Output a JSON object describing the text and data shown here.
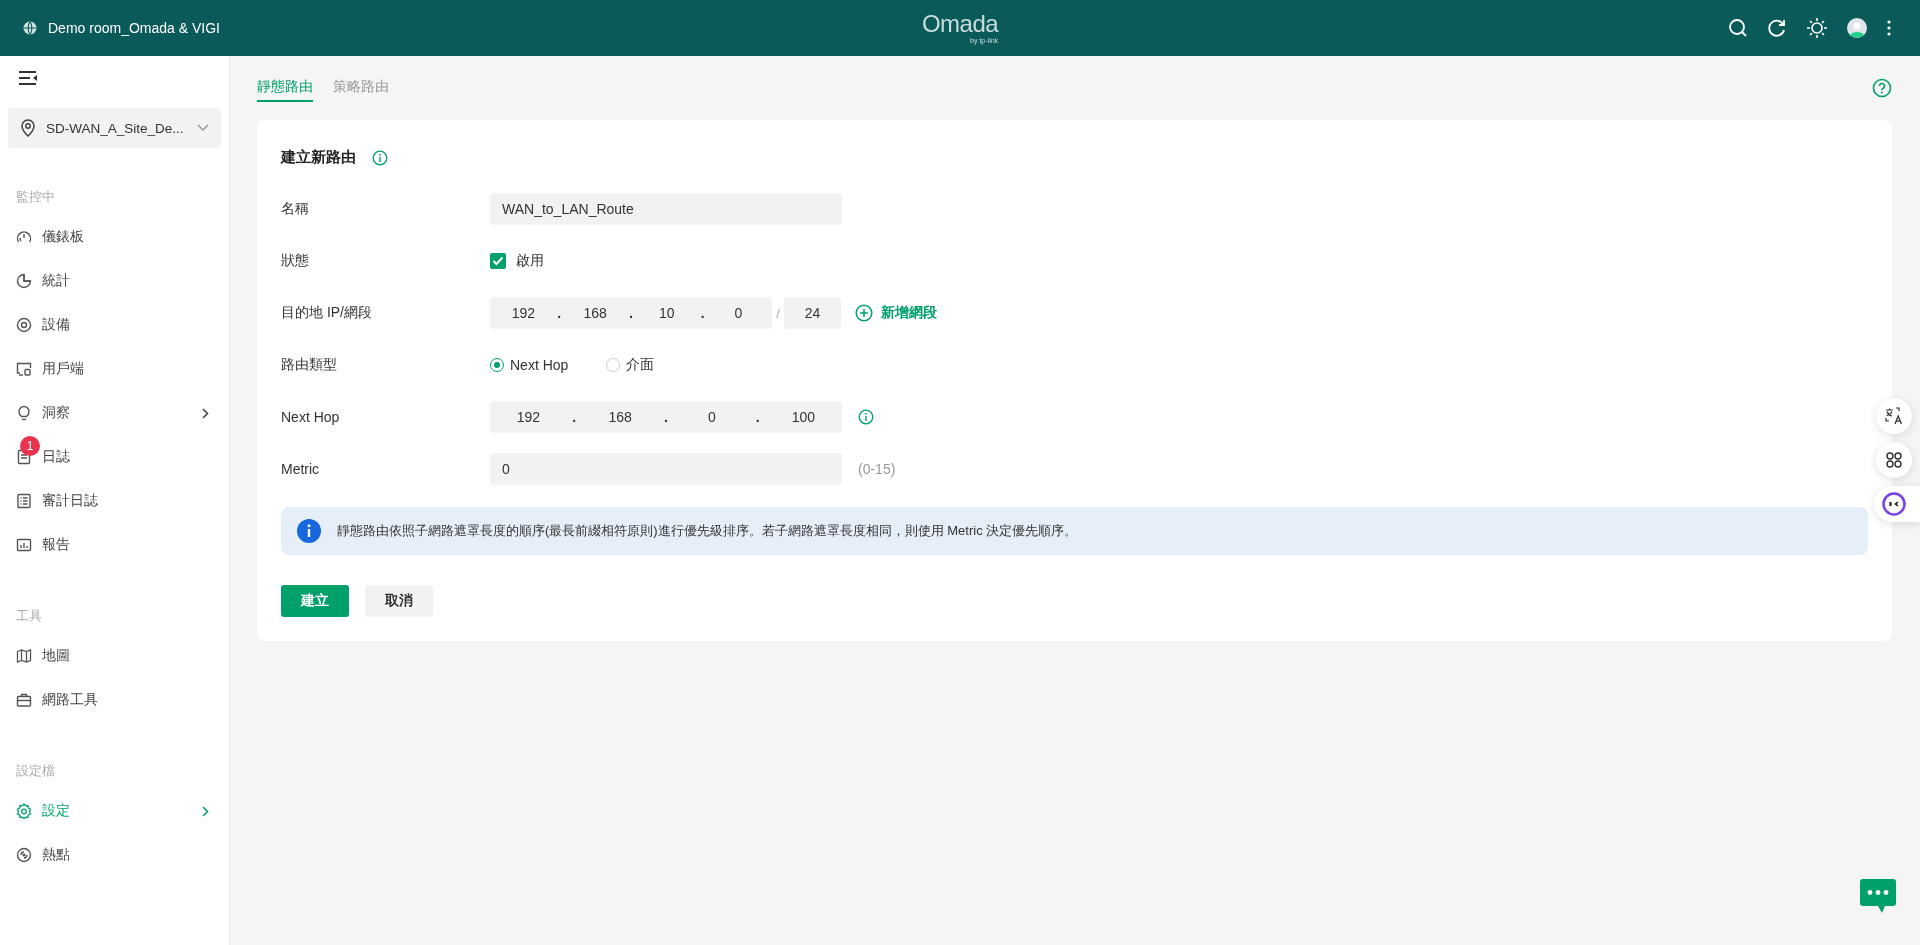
{
  "topbar": {
    "site_title": "Demo room_Omada & VIGI",
    "logo": "Omada",
    "logo_sub": "by tp-link"
  },
  "sidebar": {
    "site_selector": "SD-WAN_A_Site_De...",
    "sections": [
      {
        "title": "監控中",
        "items": [
          {
            "label": "儀錶板",
            "selected": false,
            "expandable": false
          },
          {
            "label": "統計",
            "selected": false,
            "expandable": false
          },
          {
            "label": "設備",
            "selected": false,
            "expandable": false
          },
          {
            "label": "用戶端",
            "selected": false,
            "expandable": false
          },
          {
            "label": "洞察",
            "selected": false,
            "expandable": true
          },
          {
            "label": "日誌",
            "selected": false,
            "expandable": false,
            "badge": "1"
          },
          {
            "label": "審計日誌",
            "selected": false,
            "expandable": false
          },
          {
            "label": "報告",
            "selected": false,
            "expandable": false
          }
        ]
      },
      {
        "title": "工具",
        "items": [
          {
            "label": "地圖",
            "selected": false,
            "expandable": false
          },
          {
            "label": "網路工具",
            "selected": false,
            "expandable": false
          }
        ]
      },
      {
        "title": "設定檔",
        "items": [
          {
            "label": "設定",
            "selected": true,
            "expandable": true
          },
          {
            "label": "熱點",
            "selected": false,
            "expandable": false
          }
        ]
      }
    ]
  },
  "tabs": [
    {
      "label": "靜態路由",
      "selected": true
    },
    {
      "label": "策略路由",
      "selected": false
    }
  ],
  "form": {
    "title": "建立新路由",
    "rows": [
      {
        "kind": "text",
        "label": "名稱",
        "value": "WAN_to_LAN_Route"
      },
      {
        "kind": "checkbox",
        "label": "狀態",
        "option": "啟用",
        "checked": true
      },
      {
        "kind": "ip_mask",
        "label": "目的地 IP/網段",
        "octets": [
          "192",
          "168",
          "10",
          "0"
        ],
        "separator": "/",
        "mask": "24",
        "action": "新增網段"
      },
      {
        "kind": "radio",
        "label": "路由類型",
        "options": [
          {
            "label": "Next Hop",
            "selected": true
          },
          {
            "label": "介面",
            "selected": false
          }
        ]
      },
      {
        "kind": "ip",
        "label": "Next Hop",
        "octets": [
          "192",
          "168",
          "0",
          "100"
        ],
        "dot": "."
      },
      {
        "kind": "text",
        "label": "Metric",
        "value": "0",
        "hint": "(0-15)"
      }
    ],
    "dot": ".",
    "notice": "靜態路由依照子網路遮罩長度的順序(最長前綴相符原則)進行優先級排序。若子網路遮罩長度相同，則使用 Metric 決定優先順序。",
    "buttons": [
      {
        "label": "建立",
        "kind": "primary"
      },
      {
        "label": "取消",
        "kind": "secondary"
      }
    ]
  }
}
